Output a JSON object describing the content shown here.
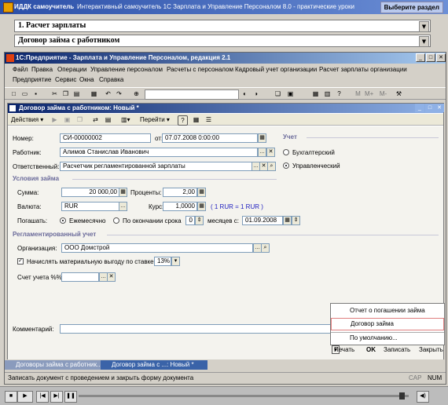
{
  "tutorial": {
    "brand": "ИДДК самоучитель",
    "title": "Интерактивный самоучитель 1С Зарплата и Управление Персоналом 8.0 - практические уроки",
    "section_button": "Выберите раздел",
    "chapter": "1. Расчет зарплаты",
    "lesson": "Договор займа с работником"
  },
  "app": {
    "title": "1С:Предприятие - Зарплата и Управление Персоналом, редакция 2.1",
    "menu_row1": [
      "Файл",
      "Правка",
      "Операции",
      "Управление персоналом",
      "Расчеты с персоналом",
      "Кадровый учет организации",
      "Расчет зарплаты организации"
    ],
    "menu_row2": [
      "Предприятие",
      "Сервис",
      "Окна",
      "Справка"
    ]
  },
  "doc": {
    "title": "Договор займа с работником: Новый *",
    "actions": "Действия",
    "goto": "Перейти",
    "number_label": "Номер:",
    "number": "СИ-00000002",
    "date_label": "от:",
    "date": "07.07.2008  0:00:00",
    "employee_label": "Работник:",
    "employee": "Алимов Станислав Иванович",
    "responsible_label": "Ответственный:",
    "responsible": "Расчетчик регламентированной зарплаты",
    "accounting_section": "Учет",
    "acc_buh": "Бухгалтерский",
    "acc_mgmt": "Управленческий",
    "loan_section": "Условия займа",
    "sum_label": "Сумма:",
    "sum": "20 000,00",
    "percent_label": "Проценты:",
    "percent": "2,00",
    "currency_label": "Валюта:",
    "currency": "RUR",
    "rate_label": "Курс:",
    "rate": "1,0000",
    "rate_info": "( 1 RUR = 1 RUR )",
    "repay_label": "Погашать:",
    "repay_monthly": "Ежемесячно",
    "repay_end": "По окончании срока",
    "months": "0",
    "months_from": "месяцев с:",
    "start_date": "01.09.2008",
    "reg_section": "Регламентированный учет",
    "org_label": "Организация:",
    "org": "ООО Домстрой",
    "benefit_label": "Начислять материальную выгоду по ставке:",
    "benefit_rate": "13%",
    "account_label": "Счет учета %%:",
    "account": "",
    "comment_label": "Комментарий:",
    "comment": ""
  },
  "popup": {
    "items": [
      "Отчет о погашении займа",
      "Договор займа",
      "По умолчанию..."
    ]
  },
  "buttons": {
    "print": "Печать",
    "ok": "OK",
    "save": "Записать",
    "close": "Закрыть"
  },
  "taskbar": {
    "task1": "Договоры займа с работник...",
    "task2": "Договор займа с ...: Новый *"
  },
  "statusbar": {
    "text": "Записать документ с проведением и закрыть форму документа",
    "cap": "CAP",
    "num": "NUM"
  }
}
